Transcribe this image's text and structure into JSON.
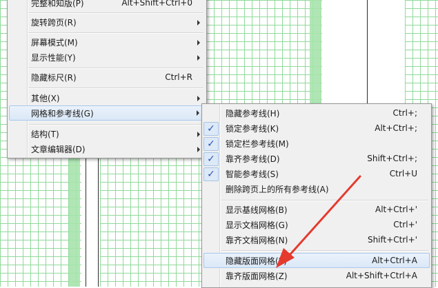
{
  "colors": {
    "grid_line": "#8fd99a",
    "grid_fill_column": "#a7e3ad",
    "menu_bg": "#f0f0f0",
    "highlight_border": "#a8c8ec",
    "arrow_red": "#e53a2e"
  },
  "main_menu": {
    "items": [
      {
        "label": "完整和知版(P)",
        "shortcut": "Alt+Shift+Ctrl+0",
        "submenu": false
      },
      {
        "label": "旋转跨页(R)",
        "shortcut": "",
        "submenu": true
      },
      {
        "label": "屏幕模式(M)",
        "shortcut": "",
        "submenu": true
      },
      {
        "label": "显示性能(Y)",
        "shortcut": "",
        "submenu": true
      },
      {
        "label": "隐藏标尺(R)",
        "shortcut": "Ctrl+R",
        "submenu": false
      },
      {
        "label": "其他(X)",
        "shortcut": "",
        "submenu": true
      },
      {
        "label": "网格和参考线(G)",
        "shortcut": "",
        "submenu": true,
        "highlighted": true
      },
      {
        "label": "结构(T)",
        "shortcut": "",
        "submenu": true
      },
      {
        "label": "文章编辑器(D)",
        "shortcut": "",
        "submenu": true
      }
    ]
  },
  "sub_menu": {
    "items": [
      {
        "label": "隐藏参考线(H)",
        "shortcut": "Ctrl+;",
        "checked": false
      },
      {
        "label": "锁定参考线(K)",
        "shortcut": "Alt+Ctrl+;",
        "checked": true
      },
      {
        "label": "锁定栏参考线(M)",
        "shortcut": "",
        "checked": true
      },
      {
        "label": "靠齐参考线(D)",
        "shortcut": "Shift+Ctrl+;",
        "checked": true
      },
      {
        "label": "智能参考线(S)",
        "shortcut": "Ctrl+U",
        "checked": true
      },
      {
        "label": "删除跨页上的所有参考线(A)",
        "shortcut": "",
        "checked": false
      },
      {
        "label": "显示基线网格(B)",
        "shortcut": "Alt+Ctrl+'",
        "checked": false
      },
      {
        "label": "显示文档网格(G)",
        "shortcut": "Ctrl+'",
        "checked": false
      },
      {
        "label": "靠齐文档网格(N)",
        "shortcut": "Shift+Ctrl+'",
        "checked": false
      },
      {
        "label": "隐藏版面网格(E)",
        "shortcut": "Alt+Ctrl+A",
        "checked": false,
        "highlighted": true
      },
      {
        "label": "靠齐版面网格(Z)",
        "shortcut": "Alt+Shift+Ctrl+A",
        "checked": false
      }
    ],
    "check_glyph": "✓"
  }
}
